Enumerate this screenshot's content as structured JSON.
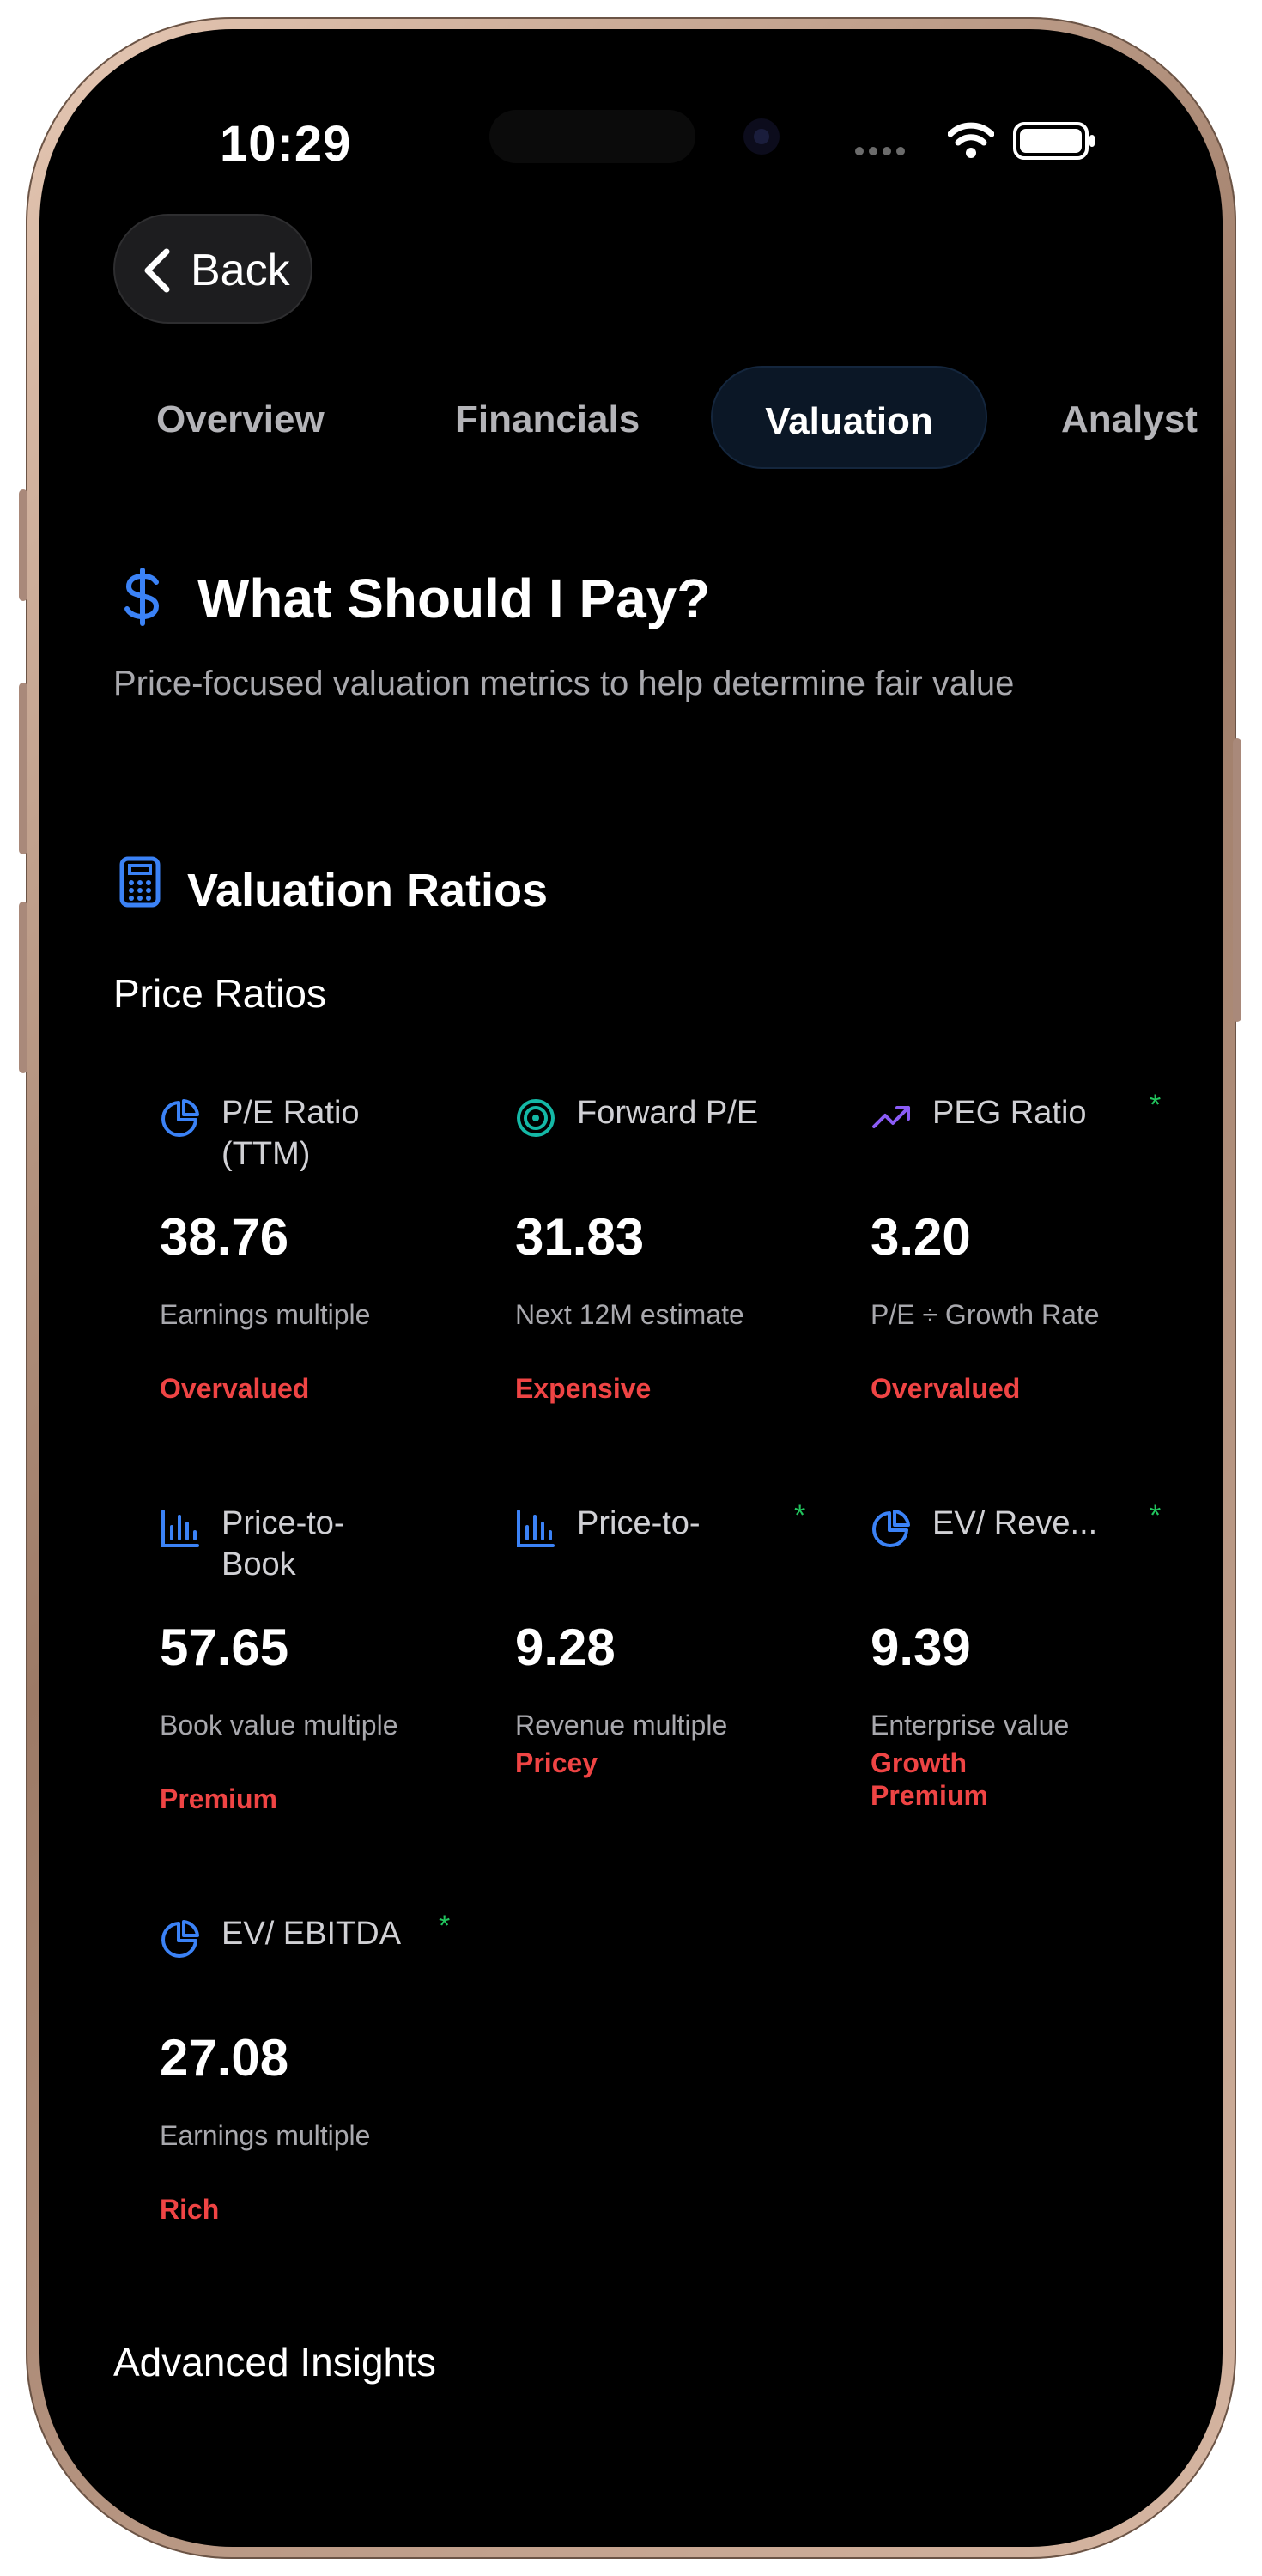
{
  "status_bar": {
    "time": "10:29",
    "wifi_icon": "wifi-icon",
    "battery_icon": "battery-icon"
  },
  "header": {
    "back_label": "Back"
  },
  "tabs": [
    {
      "label": "Overview",
      "active": false
    },
    {
      "label": "Financials",
      "active": false
    },
    {
      "label": "Valuation",
      "active": true
    },
    {
      "label": "Analyst",
      "active": false
    }
  ],
  "page": {
    "title": "What Should I Pay?",
    "subtitle": "Price-focused valuation metrics to help determine fair value",
    "title_icon": "dollar-icon"
  },
  "section": {
    "title": "Valuation Ratios",
    "icon": "calculator-icon",
    "subheading": "Price Ratios"
  },
  "metrics": [
    {
      "name": "P/E Ratio (TTM)",
      "value": "38.76",
      "desc": "Earnings multiple",
      "tag": "Overvalued",
      "icon": "pie-chart-icon",
      "star": ""
    },
    {
      "name": "Forward P/E",
      "value": "31.83",
      "desc": "Next 12M estimate",
      "tag": "Expensive",
      "icon": "target-icon",
      "star": ""
    },
    {
      "name": "PEG Ratio",
      "value": "3.20",
      "desc": "P/E ÷ Growth Rate",
      "tag": "Overvalued",
      "icon": "trending-up-icon",
      "star": "*"
    },
    {
      "name": "Price-to-Book",
      "value": "57.65",
      "desc": "Book value multiple",
      "tag": "Premium",
      "icon": "bar-chart-icon",
      "star": ""
    },
    {
      "name": "Price-to-",
      "value": "9.28",
      "desc": "Revenue multiple",
      "tag": "Pricey",
      "icon": "bar-chart-icon",
      "star": "*"
    },
    {
      "name": "EV/ Reve...",
      "value": "9.39",
      "desc": "Enterprise value",
      "tag": "Growth Premium",
      "icon": "pie-chart-icon",
      "star": "*"
    },
    {
      "name": "EV/ EBITDA",
      "value": "27.08",
      "desc": "Earnings multiple",
      "tag": "Rich",
      "icon": "pie-chart-icon",
      "star": "*"
    }
  ],
  "advanced": {
    "title": "Advanced Insights"
  },
  "colors": {
    "accent": "#3b82f6",
    "danger": "#ef4444",
    "star": "#22c55e",
    "teal": "#14b8a6",
    "violet": "#8b5cf6"
  }
}
